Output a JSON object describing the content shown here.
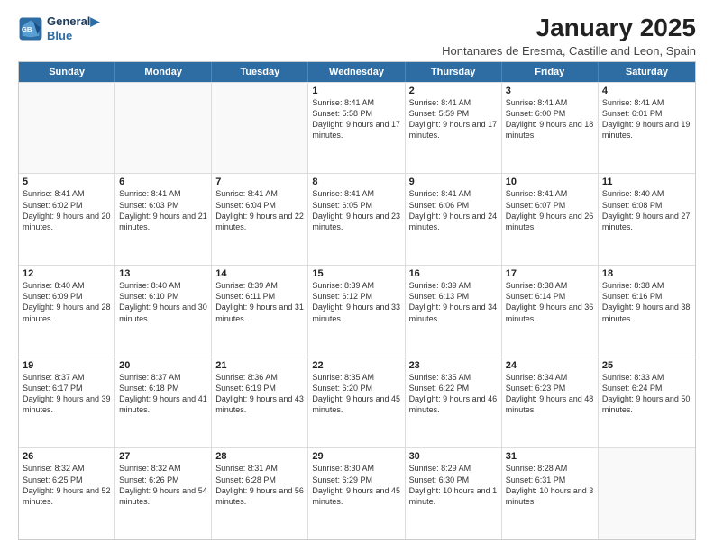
{
  "logo": {
    "line1": "General",
    "line2": "Blue"
  },
  "title": "January 2025",
  "subtitle": "Hontanares de Eresma, Castille and Leon, Spain",
  "header_days": [
    "Sunday",
    "Monday",
    "Tuesday",
    "Wednesday",
    "Thursday",
    "Friday",
    "Saturday"
  ],
  "weeks": [
    [
      {
        "day": "",
        "info": ""
      },
      {
        "day": "",
        "info": ""
      },
      {
        "day": "",
        "info": ""
      },
      {
        "day": "1",
        "info": "Sunrise: 8:41 AM\nSunset: 5:58 PM\nDaylight: 9 hours and 17 minutes."
      },
      {
        "day": "2",
        "info": "Sunrise: 8:41 AM\nSunset: 5:59 PM\nDaylight: 9 hours and 17 minutes."
      },
      {
        "day": "3",
        "info": "Sunrise: 8:41 AM\nSunset: 6:00 PM\nDaylight: 9 hours and 18 minutes."
      },
      {
        "day": "4",
        "info": "Sunrise: 8:41 AM\nSunset: 6:01 PM\nDaylight: 9 hours and 19 minutes."
      }
    ],
    [
      {
        "day": "5",
        "info": "Sunrise: 8:41 AM\nSunset: 6:02 PM\nDaylight: 9 hours and 20 minutes."
      },
      {
        "day": "6",
        "info": "Sunrise: 8:41 AM\nSunset: 6:03 PM\nDaylight: 9 hours and 21 minutes."
      },
      {
        "day": "7",
        "info": "Sunrise: 8:41 AM\nSunset: 6:04 PM\nDaylight: 9 hours and 22 minutes."
      },
      {
        "day": "8",
        "info": "Sunrise: 8:41 AM\nSunset: 6:05 PM\nDaylight: 9 hours and 23 minutes."
      },
      {
        "day": "9",
        "info": "Sunrise: 8:41 AM\nSunset: 6:06 PM\nDaylight: 9 hours and 24 minutes."
      },
      {
        "day": "10",
        "info": "Sunrise: 8:41 AM\nSunset: 6:07 PM\nDaylight: 9 hours and 26 minutes."
      },
      {
        "day": "11",
        "info": "Sunrise: 8:40 AM\nSunset: 6:08 PM\nDaylight: 9 hours and 27 minutes."
      }
    ],
    [
      {
        "day": "12",
        "info": "Sunrise: 8:40 AM\nSunset: 6:09 PM\nDaylight: 9 hours and 28 minutes."
      },
      {
        "day": "13",
        "info": "Sunrise: 8:40 AM\nSunset: 6:10 PM\nDaylight: 9 hours and 30 minutes."
      },
      {
        "day": "14",
        "info": "Sunrise: 8:39 AM\nSunset: 6:11 PM\nDaylight: 9 hours and 31 minutes."
      },
      {
        "day": "15",
        "info": "Sunrise: 8:39 AM\nSunset: 6:12 PM\nDaylight: 9 hours and 33 minutes."
      },
      {
        "day": "16",
        "info": "Sunrise: 8:39 AM\nSunset: 6:13 PM\nDaylight: 9 hours and 34 minutes."
      },
      {
        "day": "17",
        "info": "Sunrise: 8:38 AM\nSunset: 6:14 PM\nDaylight: 9 hours and 36 minutes."
      },
      {
        "day": "18",
        "info": "Sunrise: 8:38 AM\nSunset: 6:16 PM\nDaylight: 9 hours and 38 minutes."
      }
    ],
    [
      {
        "day": "19",
        "info": "Sunrise: 8:37 AM\nSunset: 6:17 PM\nDaylight: 9 hours and 39 minutes."
      },
      {
        "day": "20",
        "info": "Sunrise: 8:37 AM\nSunset: 6:18 PM\nDaylight: 9 hours and 41 minutes."
      },
      {
        "day": "21",
        "info": "Sunrise: 8:36 AM\nSunset: 6:19 PM\nDaylight: 9 hours and 43 minutes."
      },
      {
        "day": "22",
        "info": "Sunrise: 8:35 AM\nSunset: 6:20 PM\nDaylight: 9 hours and 45 minutes."
      },
      {
        "day": "23",
        "info": "Sunrise: 8:35 AM\nSunset: 6:22 PM\nDaylight: 9 hours and 46 minutes."
      },
      {
        "day": "24",
        "info": "Sunrise: 8:34 AM\nSunset: 6:23 PM\nDaylight: 9 hours and 48 minutes."
      },
      {
        "day": "25",
        "info": "Sunrise: 8:33 AM\nSunset: 6:24 PM\nDaylight: 9 hours and 50 minutes."
      }
    ],
    [
      {
        "day": "26",
        "info": "Sunrise: 8:32 AM\nSunset: 6:25 PM\nDaylight: 9 hours and 52 minutes."
      },
      {
        "day": "27",
        "info": "Sunrise: 8:32 AM\nSunset: 6:26 PM\nDaylight: 9 hours and 54 minutes."
      },
      {
        "day": "28",
        "info": "Sunrise: 8:31 AM\nSunset: 6:28 PM\nDaylight: 9 hours and 56 minutes."
      },
      {
        "day": "29",
        "info": "Sunrise: 8:30 AM\nSunset: 6:29 PM\nDaylight: 9 hours and 45 minutes."
      },
      {
        "day": "30",
        "info": "Sunrise: 8:29 AM\nSunset: 6:30 PM\nDaylight: 10 hours and 1 minute."
      },
      {
        "day": "31",
        "info": "Sunrise: 8:28 AM\nSunset: 6:31 PM\nDaylight: 10 hours and 3 minutes."
      },
      {
        "day": "",
        "info": ""
      }
    ]
  ]
}
